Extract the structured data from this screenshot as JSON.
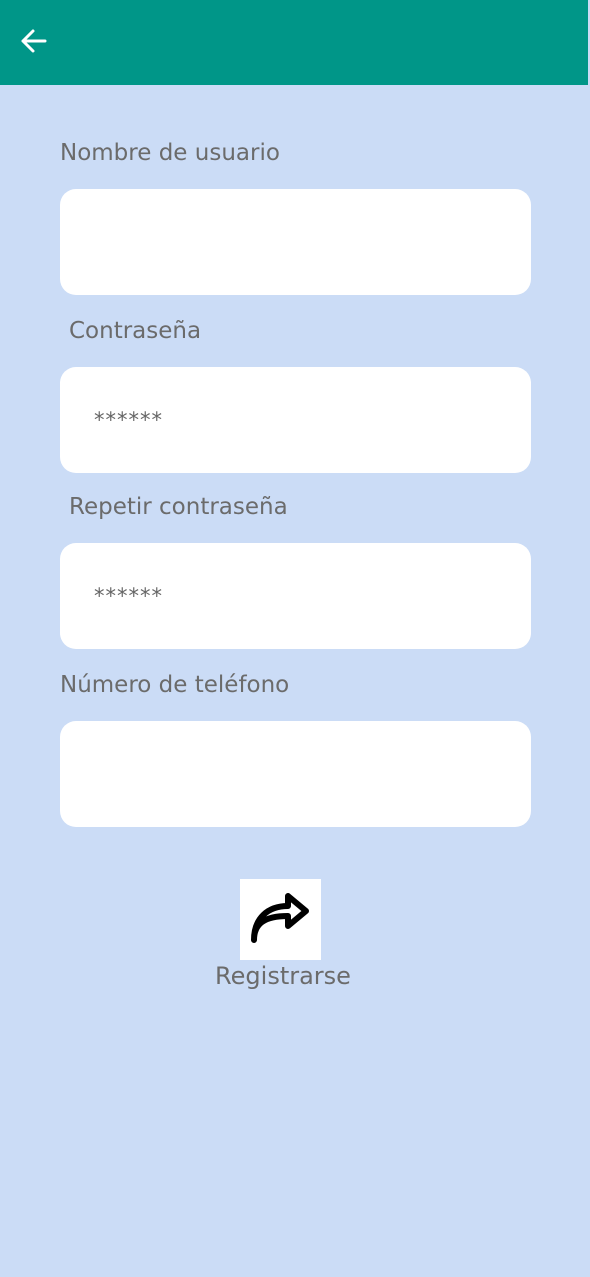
{
  "header": {
    "background": "#009688",
    "back_icon": "arrow-left-icon"
  },
  "form": {
    "username": {
      "label": "Nombre de usuario",
      "value": "",
      "placeholder": ""
    },
    "password": {
      "label": "Contraseña",
      "value": "",
      "placeholder": "******"
    },
    "repeat_password": {
      "label": "Repetir contraseña",
      "value": "",
      "placeholder": "******"
    },
    "phone": {
      "label": "Número de teléfono",
      "value": "",
      "placeholder": ""
    }
  },
  "register": {
    "icon": "share-arrow-icon",
    "label": "Registrarse"
  },
  "colors": {
    "background": "#cbdcf6",
    "field": "#ffffff",
    "text": "#6b6b6b"
  }
}
